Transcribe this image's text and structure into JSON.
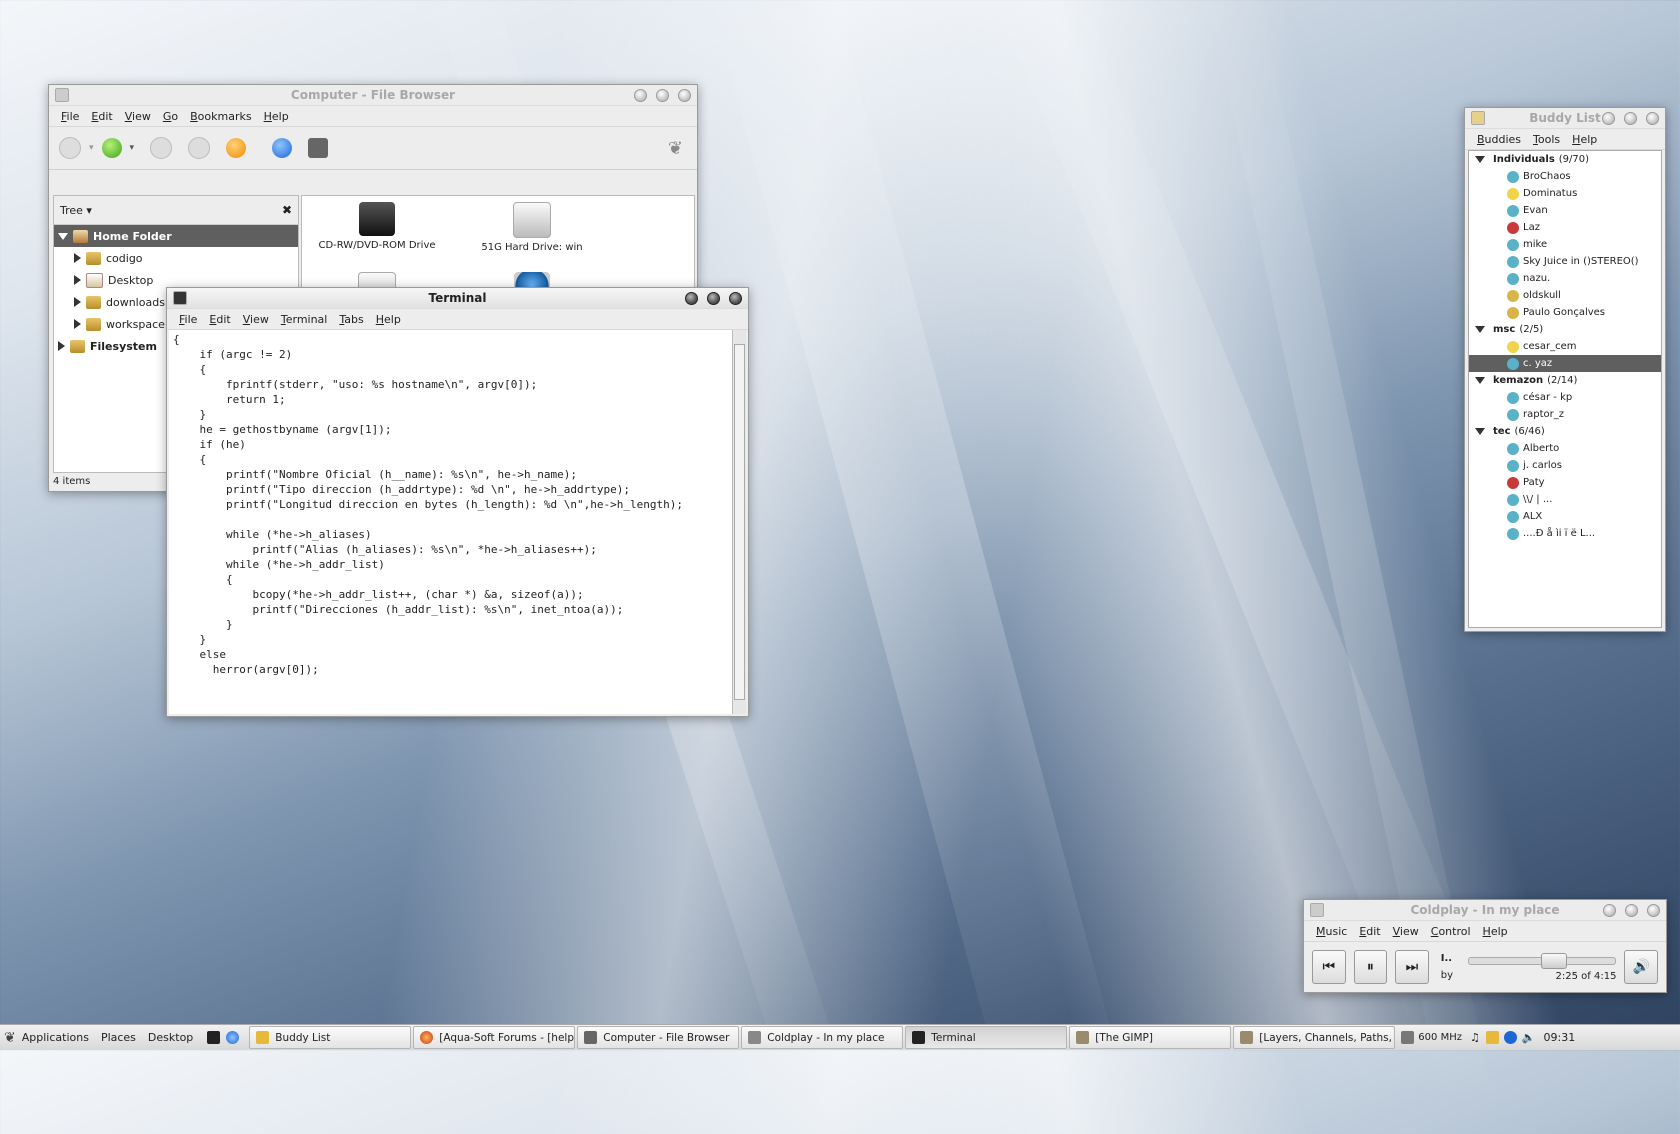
{
  "file_browser": {
    "title": "Computer - File Browser",
    "menu": [
      "File",
      "Edit",
      "View",
      "Go",
      "Bookmarks",
      "Help"
    ],
    "sidebar_mode": "Tree",
    "tree": [
      {
        "label": "Home Folder",
        "level": 0,
        "expanded": true,
        "selected": true
      },
      {
        "label": "codigo",
        "level": 1
      },
      {
        "label": "Desktop",
        "level": 1
      },
      {
        "label": "downloads",
        "level": 1
      },
      {
        "label": "workspace",
        "level": 1
      },
      {
        "label": "Filesystem",
        "level": 0
      }
    ],
    "drives": [
      "CD-RW/DVD-ROM Drive",
      "51G Hard Drive: win"
    ],
    "status": "4 items"
  },
  "terminal": {
    "title": "Terminal",
    "menu": [
      "File",
      "Edit",
      "View",
      "Terminal",
      "Tabs",
      "Help"
    ],
    "content": "{\n    if (argc != 2)\n    {\n        fprintf(stderr, \"uso: %s hostname\\n\", argv[0]);\n        return 1;\n    }\n    he = gethostbyname (argv[1]);\n    if (he)\n    {\n        printf(\"Nombre Oficial (h__name): %s\\n\", he->h_name);\n        printf(\"Tipo direccion (h_addrtype): %d \\n\", he->h_addrtype);\n        printf(\"Longitud direccion en bytes (h_length): %d \\n\",he->h_length);\n\n        while (*he->h_aliases)\n            printf(\"Alias (h_aliases): %s\\n\", *he->h_aliases++);\n        while (*he->h_addr_list)\n        {\n            bcopy(*he->h_addr_list++, (char *) &a, sizeof(a));\n            printf(\"Direcciones (h_addr_list): %s\\n\", inet_ntoa(a));\n        }\n    }\n    else\n      herror(argv[0]);"
  },
  "buddy_list": {
    "title": "Buddy List",
    "menu": [
      "Buddies",
      "Tools",
      "Help"
    ],
    "groups": [
      {
        "name": "Individuals",
        "count": "(9/70)",
        "buddies": [
          "BroChaos",
          "Dominatus",
          "Evan",
          "Laz",
          "mike",
          "Sky Juice in ()STEREO()",
          "nazu.",
          "oldskull",
          "Paulo Gonçalves"
        ]
      },
      {
        "name": "msc",
        "count": "(2/5)",
        "buddies": [
          "cesar_cem",
          "c. yaz"
        ]
      },
      {
        "name": "kemazon",
        "count": "(2/14)",
        "buddies": [
          "césar - kp",
          "raptor_z"
        ]
      },
      {
        "name": "tec",
        "count": "(6/46)",
        "buddies": [
          "Alberto",
          "j. carlos",
          "Paty",
          "\\\\/ | ...",
          "ALX",
          "....Ð å ìi ï ë L..."
        ]
      }
    ],
    "selected": "c. yaz"
  },
  "player": {
    "title": "Coldplay - In my place",
    "menu": [
      "Music",
      "Edit",
      "View",
      "Control",
      "Help"
    ],
    "track_short": "I..",
    "by": "by",
    "time": "2:25 of 4:15",
    "progress": 0.57
  },
  "taskbar": {
    "menus": [
      "Applications",
      "Places",
      "Desktop"
    ],
    "tasks": [
      "Buddy List",
      "[Aqua-Soft Forums - [help] ...",
      "Computer - File Browser",
      "Coldplay - In my place",
      "Terminal",
      "[The GIMP]",
      "[Layers, Channels, Paths, U..."
    ],
    "active_task": "Terminal",
    "cpu": "600 MHz",
    "clock": "09:31"
  }
}
